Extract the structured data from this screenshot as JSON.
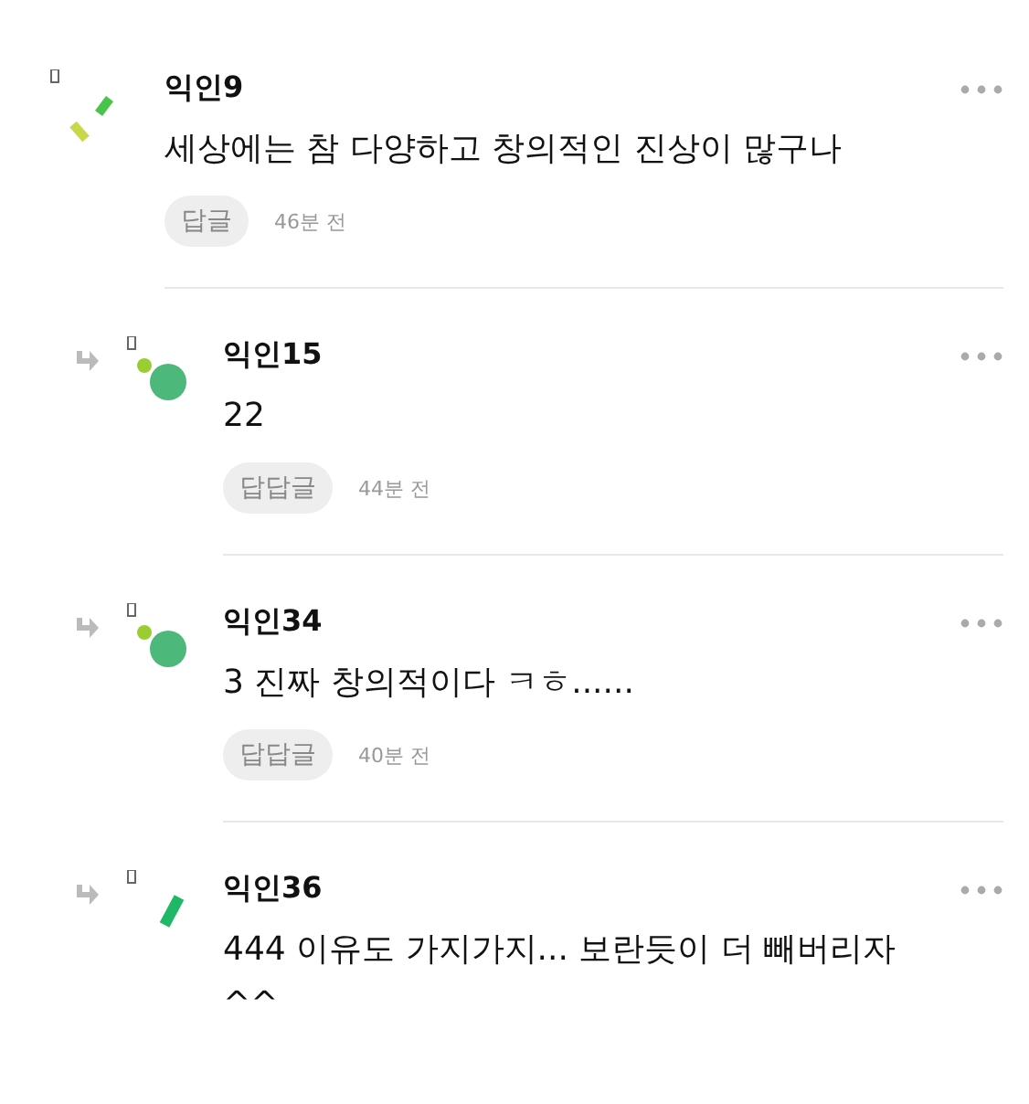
{
  "comments": [
    {
      "author": "익인9",
      "is_reply": false,
      "avatar": {
        "kind": "sticks"
      },
      "text": "세상에는 참 다양하고 창의적인 진상이 많구나",
      "reply_button": "답글",
      "time": "46분 전"
    },
    {
      "author": "익인15",
      "is_reply": true,
      "avatar": {
        "kind": "dots"
      },
      "text": "22",
      "reply_button": "답답글",
      "time": "44분 전"
    },
    {
      "author": "익인34",
      "is_reply": true,
      "avatar": {
        "kind": "dots"
      },
      "text": "3 진짜 창의적이다 ㅋㅎ......",
      "reply_button": "답답글",
      "time": "40분 전"
    },
    {
      "author": "익인36",
      "is_reply": true,
      "avatar": {
        "kind": "bar"
      },
      "text": "444 이유도 가지가지... 보란듯이 더 빼버리자 ^^"
    }
  ]
}
